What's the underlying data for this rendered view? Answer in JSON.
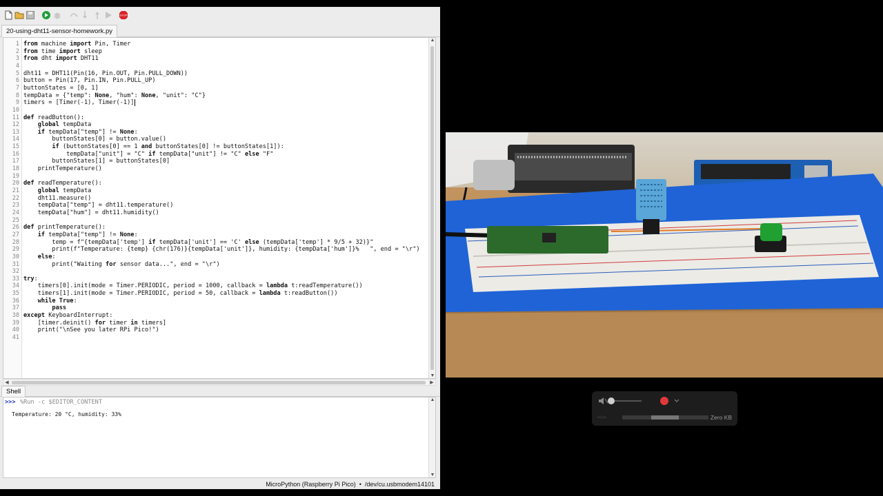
{
  "ide": {
    "toolbar": {
      "buttons": [
        {
          "name": "new-file-button",
          "icon": "new-file-icon"
        },
        {
          "name": "open-file-button",
          "icon": "folder-icon"
        },
        {
          "name": "save-button",
          "icon": "save-icon"
        },
        {
          "name": "run-button",
          "icon": "run-icon"
        },
        {
          "name": "debug-button",
          "icon": "bug-icon"
        },
        {
          "name": "step-over-button",
          "icon": "step-over-icon"
        },
        {
          "name": "step-into-button",
          "icon": "step-into-icon"
        },
        {
          "name": "step-out-button",
          "icon": "step-out-icon"
        },
        {
          "name": "resume-button",
          "icon": "resume-icon"
        },
        {
          "name": "stop-button",
          "icon": "stop-icon",
          "label": "STOP"
        }
      ],
      "colors": {
        "run": "#1f9e3a",
        "stop": "#d9242a",
        "disabled": "#b8b8b8"
      }
    },
    "editor_tab": {
      "title": "20-using-dht11-sensor-homework.py"
    },
    "code_lines": [
      "from machine import Pin, Timer",
      "from time import sleep",
      "from dht import DHT11",
      "",
      "dht11 = DHT11(Pin(16, Pin.OUT, Pin.PULL_DOWN))",
      "button = Pin(17, Pin.IN, Pin.PULL_UP)",
      "buttonStates = [0, 1]",
      "tempData = {\"temp\": None, \"hum\": None, \"unit\": \"C\"}",
      "timers = [Timer(-1), Timer(-1)]",
      "",
      "def readButton():",
      "    global tempData",
      "    if tempData[\"temp\"] != None:",
      "        buttonStates[0] = button.value()",
      "        if (buttonStates[0] == 1 and buttonStates[0] != buttonStates[1]):",
      "            tempData[\"unit\"] = \"C\" if tempData[\"unit\"] != \"C\" else \"F\"",
      "        buttonStates[1] = buttonStates[0]",
      "    printTemperature()",
      "",
      "def readTemperature():",
      "    global tempData",
      "    dht11.measure()",
      "    tempData[\"temp\"] = dht11.temperature()",
      "    tempData[\"hum\"] = dht11.humidity()",
      "",
      "def printTemperature():",
      "    if tempData[\"temp\"] != None:",
      "        temp = f\"{tempData['temp'] if tempData['unit'] == 'C' else (tempData['temp'] * 9/5 + 32)}\"",
      "        print(f\"Temperature: {temp} {chr(176)}{tempData['unit']}, humidity: {tempData['hum']}%   \", end = \"\\r\")",
      "    else:",
      "        print(\"Waiting for sensor data...\", end = \"\\r\")",
      "",
      "try:",
      "    timers[0].init(mode = Timer.PERIODIC, period = 1000, callback = lambda t:readTemperature())",
      "    timers[1].init(mode = Timer.PERIODIC, period = 50, callback = lambda t:readButton())",
      "    while True:",
      "        pass",
      "except KeyboardInterrupt:",
      "    [timer.deinit() for timer in timers]",
      "    print(\"\\nSee you later RPi Pico!\")",
      ""
    ],
    "keywords": [
      "from",
      "import",
      "def",
      "global",
      "if",
      "and",
      "else",
      "None",
      "try",
      "while",
      "True",
      "pass",
      "except",
      "for",
      "in",
      "lambda"
    ],
    "caret_line": 9,
    "shell": {
      "tab_label": "Shell",
      "prompt": ">>>",
      "command": "%Run -c $EDITOR_CONTENT",
      "output": "Temperature: 20 °C, humidity: 33%"
    },
    "status": {
      "interpreter": "MicroPython (Raspberry Pi Pico)",
      "separator": "•",
      "port": "/dev/cu.usbmodem14101"
    }
  },
  "camera": {
    "description_colors": {
      "table": "#b78a55",
      "tray": "#1f63d6",
      "breadboard": "#ecebe6",
      "pico": "#2c6a2c",
      "sensor": "#5aa6d8",
      "button": "#1fa030"
    }
  },
  "recorder": {
    "size_label": "Zero KB",
    "time_label": "--:--",
    "record_color": "#e0393b"
  }
}
